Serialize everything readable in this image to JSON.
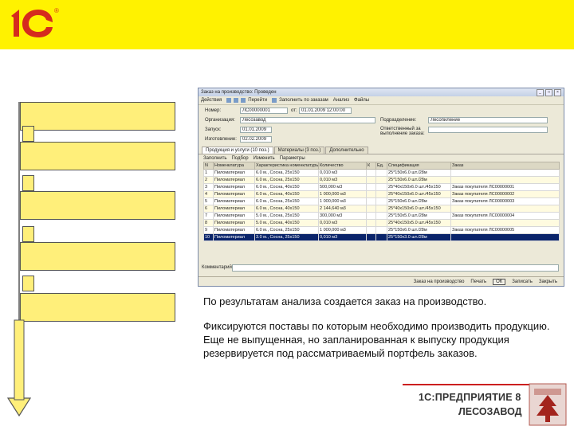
{
  "header": {
    "logo_text": "1С",
    "logo_mark": "®",
    "band_color": "#fff200"
  },
  "window": {
    "title": "Заказ на производство: Проведен",
    "toolbar": [
      "Действия",
      "Перейти",
      "Заполнить по заказам",
      "Анализ",
      "Файлы"
    ],
    "fields": {
      "number_label": "Номер:",
      "number_value": "ЛС00000001",
      "date_label": "от:",
      "date_value": "01.01.2009 12:00:00",
      "org_label": "Организация:",
      "org_value": "Лесозавод",
      "period_label": "Запуск:",
      "period_value": "01.01.2009",
      "release_label": "Изготовление:",
      "release_value": "02.02.2009",
      "dept_label": "Подразделение:",
      "dept_value": "Лесопиление",
      "resp_label": "Ответственный за выполнение заказа:"
    },
    "tabs": [
      "Продукция и услуги (10 поз.)",
      "Материалы (3 поз.)",
      "Дополнительно"
    ],
    "grid_toolbar": [
      "Заполнить",
      "Подбор",
      "Изменить",
      "Параметры"
    ],
    "columns": [
      "N",
      "Номенклатура",
      "Характеристика номенклатуры",
      "Количество",
      "К",
      "Ед.",
      "Спецификация",
      "Заказ"
    ],
    "rows": [
      [
        "1",
        "Пиломатериал",
        "6.0 м., Сосна, 25х150",
        "0,010 м3",
        "",
        "",
        "25*150х6.0 шт./28м",
        ""
      ],
      [
        "2",
        "Пиломатериал",
        "6.0 м., Сосна, 25х150",
        "0,010 м3",
        "",
        "",
        "25*150х6.0 шт./28м",
        ""
      ],
      [
        "3",
        "Пиломатериал",
        "6.0 м., Сосна, 40х150",
        "500,000 м3",
        "",
        "",
        "25*40х150х6.0 шт./45х150",
        "Заказ покупателя ЛС00000001"
      ],
      [
        "4",
        "Пиломатериал",
        "6.0 м., Сосна, 40х150",
        "1 000,000 м3",
        "",
        "",
        "25*40х150х6.0 шт./45х150",
        "Заказ покупателя ЛС00000002"
      ],
      [
        "5",
        "Пиломатериал",
        "6.0 м., Сосна, 25х150",
        "1 000,000 м3",
        "",
        "",
        "25*150х6.0 шт./28м",
        "Заказ покупателя ЛС00000003"
      ],
      [
        "6",
        "Пиломатериал",
        "6.0 м., Сосна, 40х150",
        "2 144,640 м3",
        "",
        "",
        "25*40х150х6.0 шт./45х150",
        ""
      ],
      [
        "7",
        "Пиломатериал",
        "5.0 м., Сосна, 25х150",
        "300,000 м3",
        "",
        "",
        "25*150х5.0 шт./28м",
        "Заказ покупателя ЛС00000004"
      ],
      [
        "8",
        "Пиломатериал",
        "5.0 м., Сосна, 40х150",
        "0,010 м3",
        "",
        "",
        "25*40х150х5.0 шт./45х150",
        ""
      ],
      [
        "9",
        "Пиломатериал",
        "6.0 м., Сосна, 25х150",
        "1 000,000 м3",
        "",
        "",
        "25*150х6.0 шт./28м",
        "Заказ покупателя ЛС00000005"
      ],
      [
        "10",
        "Пиломатериал",
        "3.0 м., Сосна, 25х150",
        "0,010 м3",
        "",
        "",
        "25*150х3.0 шт./28м",
        ""
      ]
    ],
    "selected_row": 9,
    "comment_label": "Комментарий:",
    "status": [
      "Заказ на производство",
      "Печать",
      "ОК",
      "Записать",
      "Закрыть"
    ]
  },
  "description": {
    "p1": "По результатам анализа создается заказ на производство.",
    "p2": "Фиксируются поставы по которым необходимо производить продукцию. Еще не выпущенная, но запланированная к выпуску продукция резервируется под рассматриваемый портфель заказов."
  },
  "brand": {
    "line1": "1С:ПРЕДПРИЯТИЕ 8",
    "line2": "ЛЕСОЗАВОД",
    "accent": "#cc1f1f"
  },
  "flow": {
    "box_color": "#ffef7a"
  }
}
